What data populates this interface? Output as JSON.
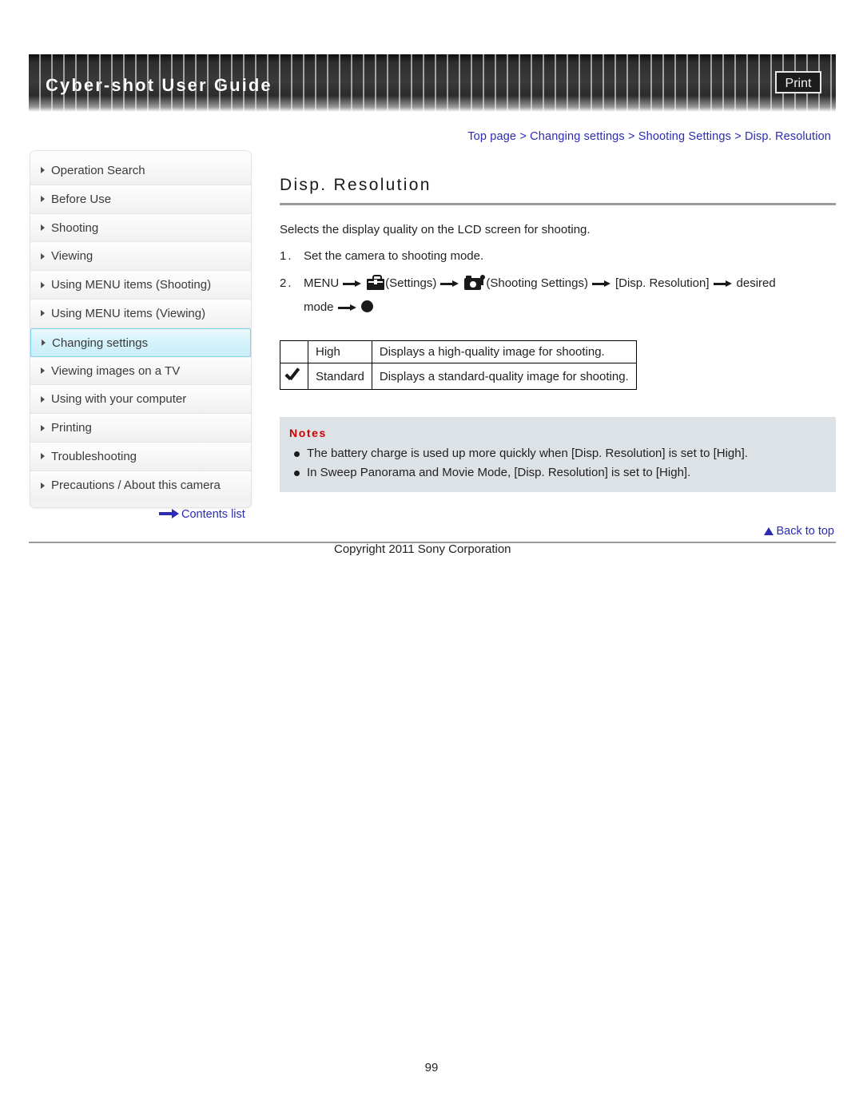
{
  "header": {
    "title": "Cyber-shot User Guide",
    "print_label": "Print"
  },
  "breadcrumb": {
    "items": [
      "Top page",
      "Changing settings",
      "Shooting Settings",
      "Disp. Resolution"
    ],
    "separator": ">"
  },
  "sidebar": {
    "items": [
      {
        "label": "Operation Search",
        "active": false
      },
      {
        "label": "Before Use",
        "active": false
      },
      {
        "label": "Shooting",
        "active": false
      },
      {
        "label": "Viewing",
        "active": false
      },
      {
        "label": "Using MENU items (Shooting)",
        "active": false
      },
      {
        "label": "Using MENU items (Viewing)",
        "active": false
      },
      {
        "label": "Changing settings",
        "active": true
      },
      {
        "label": "Viewing images on a TV",
        "active": false
      },
      {
        "label": "Using with your computer",
        "active": false
      },
      {
        "label": "Printing",
        "active": false
      },
      {
        "label": "Troubleshooting",
        "active": false
      },
      {
        "label": "Precautions / About this camera",
        "active": false
      }
    ],
    "contents_link": "Contents list"
  },
  "main": {
    "title": "Disp. Resolution",
    "intro": "Selects the display quality on the LCD screen for shooting.",
    "steps": [
      {
        "number": "1.",
        "text": "Set the camera to shooting mode."
      },
      {
        "number": "2.",
        "part1": "MENU",
        "settings_label": "(Settings)",
        "shooting_settings_label": "(Shooting Settings)",
        "menu_item": "[Disp. Resolution]",
        "desired": "desired",
        "mode": "mode"
      }
    ],
    "table": {
      "rows": [
        {
          "selected": false,
          "name": "High",
          "description": "Displays a high-quality image for shooting."
        },
        {
          "selected": true,
          "name": "Standard",
          "description": "Displays a standard-quality image for shooting."
        }
      ]
    },
    "notes": {
      "title": "Notes",
      "items": [
        "The battery charge is used up more quickly when [Disp. Resolution] is set to [High].",
        "In Sweep Panorama and Movie Mode, [Disp. Resolution] is set to [High]."
      ]
    }
  },
  "footer": {
    "back_to_top": "Back to top",
    "copyright": "Copyright 2011 Sony Corporation",
    "page_number": "99"
  },
  "colors": {
    "link": "#2b2bb5",
    "notes_title": "#cc0000",
    "notes_bg": "#dde2e6",
    "active_nav": "#c9eef9"
  }
}
